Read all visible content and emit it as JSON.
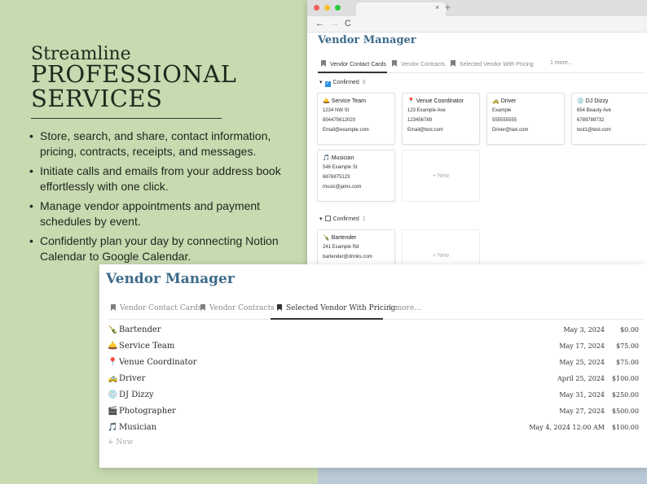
{
  "promo": {
    "headline_top": "Streamline",
    "headline_line1": "PROFESSIONAL",
    "headline_line2": "SERVICES",
    "bullets": [
      "Store, search, and share, contact information, pricing, contracts, receipts, and messages.",
      "Initiate calls and emails from your address book effortlessly with one click.",
      "Manage vendor appointments and payment schedules by event.",
      "Confidently plan your day by connecting Notion Calendar to Google Calendar."
    ]
  },
  "browser": {
    "tab_close": "×",
    "tab_plus": "+",
    "nav": {
      "back": "←",
      "forward": "→",
      "reload": "C"
    },
    "title": "Vendor Manager",
    "tabs": [
      "Vendor Contact Cards",
      "Vendor Contracts",
      "Selected Vendor With Pricing",
      "1 more..."
    ],
    "groups": [
      {
        "label": "Confirmed",
        "count": "6",
        "checked": true,
        "cards": [
          {
            "icon": "bell-icon",
            "name": "Service Team",
            "address": "1234 NW St",
            "phone": "854475612020",
            "email": "Email@example.com"
          },
          {
            "icon": "pin-icon",
            "name": "Venue Coordinator",
            "address": "123 Example Ave",
            "phone": "123456789",
            "email": "Email@test.com"
          },
          {
            "icon": "taxi-icon",
            "name": "Driver",
            "address": "Example",
            "phone": "555555555",
            "email": "Driver@taxi.com"
          },
          {
            "icon": "disc-icon",
            "name": "DJ Dizzy",
            "address": "654 Beauty Ave",
            "phone": "6789789732",
            "email": "test1@test.com"
          },
          {
            "icon": "music-icon",
            "name": "Musician",
            "address": "546 Example St",
            "phone": "6876875123",
            "email": "music@jams.com"
          }
        ]
      },
      {
        "label": "Confirmed",
        "count": "1",
        "checked": false,
        "cards": [
          {
            "icon": "bottle-icon",
            "name": "Bartender",
            "address": "241 Example Rd",
            "email": "bartender@drinks.com"
          }
        ]
      }
    ],
    "new_label": "+ New"
  },
  "panel": {
    "title": "Vendor Manager",
    "tabs": [
      "Vendor Contact Cards",
      "Vendor Contracts",
      "Selected Vendor With Pricing",
      "1 more..."
    ],
    "rows": [
      {
        "icon": "bottle-icon",
        "name": "Bartender",
        "date": "May 3, 2024",
        "price": "$0.00"
      },
      {
        "icon": "bell-icon",
        "name": "Service Team",
        "date": "May 17, 2024",
        "price": "$75.00"
      },
      {
        "icon": "pin-icon",
        "name": "Venue Coordinator",
        "date": "May 25, 2024",
        "price": "$75.00"
      },
      {
        "icon": "taxi-icon",
        "name": "Driver",
        "date": "April 25, 2024",
        "price": "$100.00"
      },
      {
        "icon": "disc-icon",
        "name": "DJ Dizzy",
        "date": "May 31, 2024",
        "price": "$250.00"
      },
      {
        "icon": "camera-icon",
        "name": "Photographer",
        "date": "May 27, 2024",
        "price": "$500.00"
      },
      {
        "icon": "music-icon",
        "name": "Musician",
        "date": "May 4, 2024 12:00 AM",
        "price": "$100.00"
      }
    ],
    "new_label": "+ New"
  }
}
